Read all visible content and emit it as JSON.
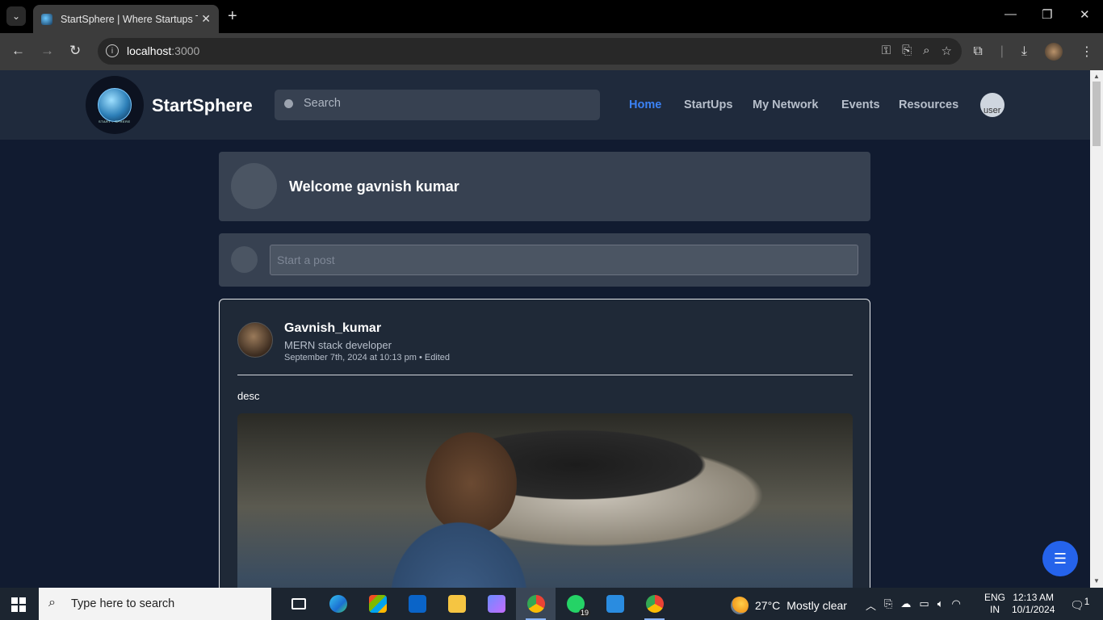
{
  "browser": {
    "tab_title": "StartSphere | Where Startups Ta",
    "url_host": "localhost",
    "url_port": ":3000"
  },
  "site": {
    "brand": "StartSphere",
    "logo_text": "START - SPHERE",
    "search_placeholder": "Search",
    "nav": [
      {
        "label": "Home",
        "active": true
      },
      {
        "label": "StartUps"
      },
      {
        "label": "My Network"
      },
      {
        "label": "Events"
      },
      {
        "label": "Resources"
      }
    ],
    "user_avatar_alt": "user"
  },
  "welcome": {
    "text": "Welcome gavnish kumar"
  },
  "composer": {
    "placeholder": "Start a post"
  },
  "post": {
    "author": "Gavnish_kumar",
    "role": "MERN stack developer",
    "time": "September 7th, 2024 at 10:13 pm • Edited",
    "desc": "desc"
  },
  "taskbar": {
    "search_text": "Type here to search",
    "whatsapp_badge": "19",
    "weather_temp": "27°C",
    "weather_desc": "Mostly clear",
    "lang_1": "ENG",
    "lang_2": "IN",
    "time": "12:13 AM",
    "date": "10/1/2024",
    "notif_count": "1"
  },
  "colors": {
    "accent": "#3b82f6",
    "page_bg": "#111b30",
    "header_bg": "#1f2a3c",
    "card_bg": "#374151",
    "fab": "#2563eb"
  }
}
